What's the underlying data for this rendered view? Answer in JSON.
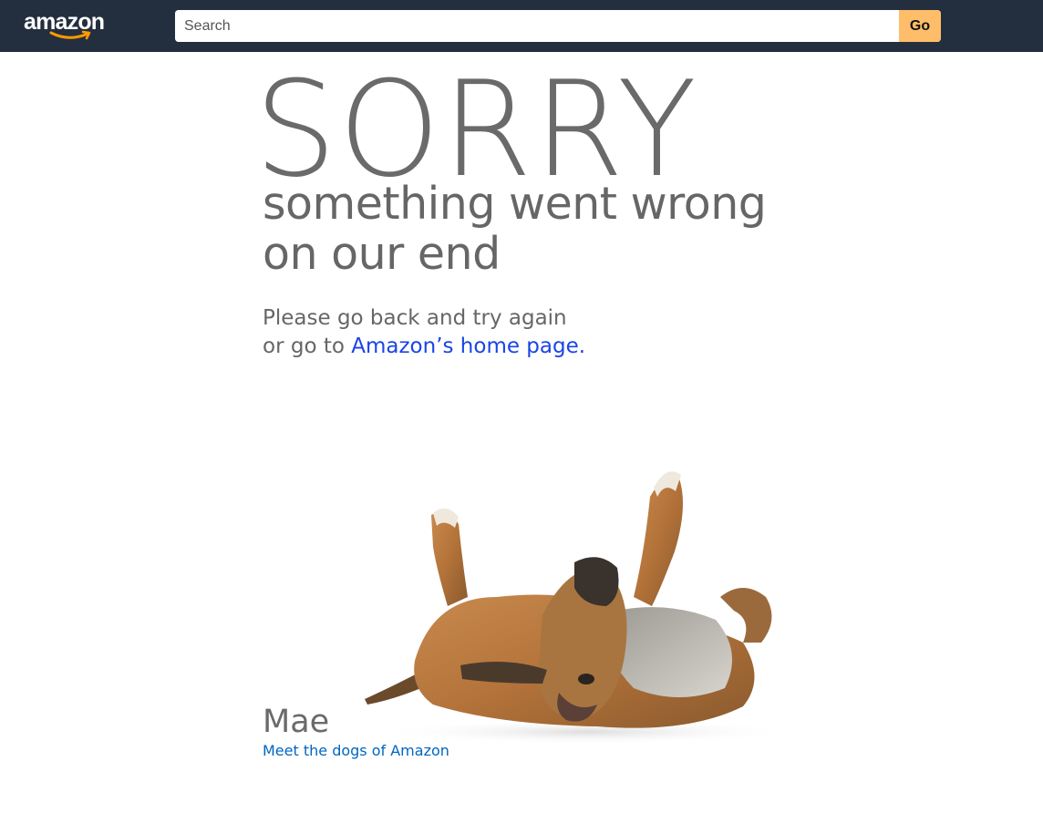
{
  "header": {
    "logo_text": "amazon",
    "search": {
      "placeholder": "Search",
      "value": ""
    },
    "go_label": "Go"
  },
  "error": {
    "headline": "SORRY",
    "subtitle_line1": "something went wrong",
    "subtitle_line2": "on our end",
    "instruction_line1": "Please go back and try again",
    "instruction_line2_prefix": "or go to ",
    "home_link": "Amazon’s home page."
  },
  "dog": {
    "name": "Mae",
    "link": "Meet the dogs of Amazon"
  },
  "colors": {
    "header_bg": "#232f3e",
    "go_button": "#febd69",
    "smile": "#ff9900",
    "text_gray": "#666666",
    "link_blue": "#1a44e6",
    "small_link_blue": "#0066c0"
  }
}
